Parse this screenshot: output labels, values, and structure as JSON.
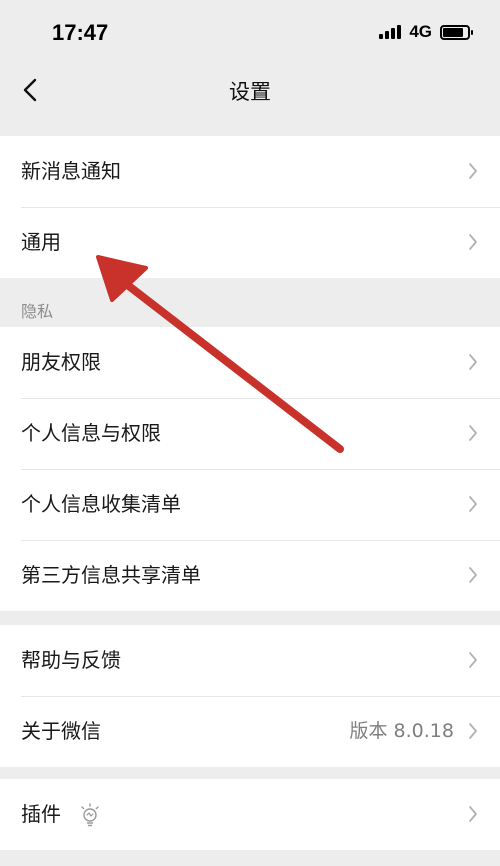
{
  "status_bar": {
    "time": "17:47",
    "network": "4G"
  },
  "nav": {
    "title": "设置",
    "back_icon": "chevron-left-icon"
  },
  "groups": [
    {
      "items": [
        {
          "label": "新消息通知"
        },
        {
          "label": "通用"
        }
      ]
    },
    {
      "header": "隐私",
      "items": [
        {
          "label": "朋友权限"
        },
        {
          "label": "个人信息与权限"
        },
        {
          "label": "个人信息收集清单"
        },
        {
          "label": "第三方信息共享清单"
        }
      ]
    },
    {
      "items": [
        {
          "label": "帮助与反馈"
        },
        {
          "label": "关于微信",
          "value": "版本 8.0.18"
        }
      ]
    },
    {
      "items": [
        {
          "label": "插件",
          "icon": "lightbulb-icon"
        }
      ]
    }
  ],
  "colors": {
    "background": "#ededed",
    "cell": "#ffffff",
    "annotation_arrow": "#c8322a"
  }
}
